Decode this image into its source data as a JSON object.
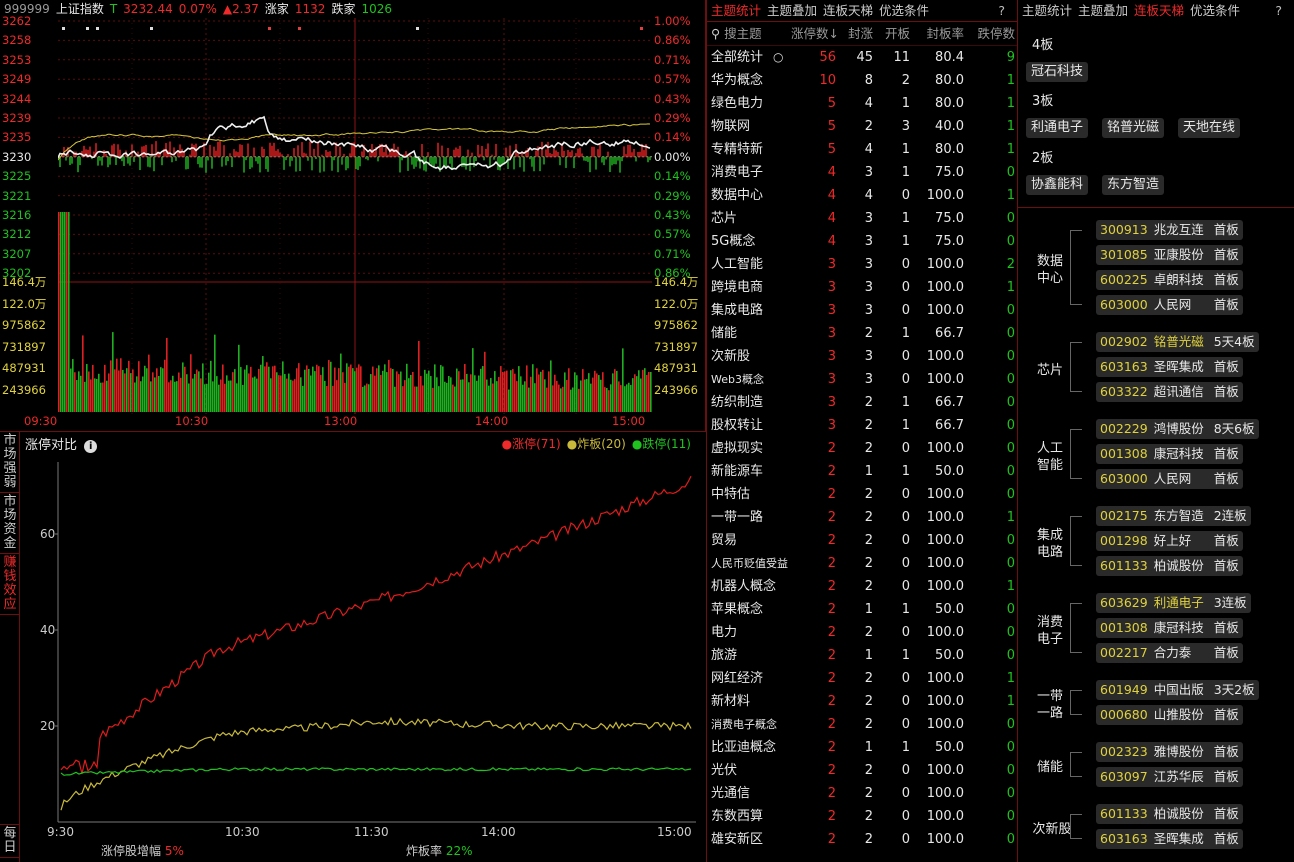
{
  "index": {
    "code": "999999",
    "name": "上证指数",
    "flag": "T",
    "price": "3232.44",
    "pct": "0.07%",
    "chg": "▲2.37",
    "up_label": "涨家",
    "up": "1132",
    "down_label": "跌家",
    "down": "1026"
  },
  "left_axis": [
    "3262",
    "3258",
    "3253",
    "3249",
    "3244",
    "3239",
    "3235",
    "3230",
    "3225",
    "3221",
    "3216",
    "3212",
    "3207",
    "3202"
  ],
  "right_axis": [
    "1.00%",
    "0.86%",
    "0.71%",
    "0.57%",
    "0.43%",
    "0.29%",
    "0.14%",
    "0.00%",
    "0.14%",
    "0.29%",
    "0.43%",
    "0.57%",
    "0.71%",
    "0.86%"
  ],
  "vol_axis": [
    "146.4万",
    "122.0万",
    "975862",
    "731897",
    "487931",
    "243966"
  ],
  "time_axis": [
    "09:30",
    "10:30",
    "13:00",
    "14:00",
    "15:00"
  ],
  "compare": {
    "title": "涨停对比",
    "legend": [
      {
        "label": "涨停(71)",
        "color": "#ee2a2a"
      },
      {
        "label": "炸板(20)",
        "color": "#c9b93a"
      },
      {
        "label": "跌停(11)",
        "color": "#1fc21f"
      }
    ],
    "y_ticks": [
      "60",
      "40",
      "20"
    ],
    "x_ticks": [
      "9:30",
      "10:30",
      "11:30",
      "14:00",
      "15:00"
    ],
    "footer_left_label": "涨停股增幅",
    "footer_left_value": "5%",
    "footer_right_label": "炸板率",
    "footer_right_value": "22%"
  },
  "chart_data": {
    "type": "line",
    "title": "涨停对比",
    "x": [
      "9:30",
      "10:30",
      "11:30",
      "14:00",
      "15:00"
    ],
    "series": [
      {
        "name": "涨停(71)",
        "values": [
          12,
          36,
          46,
          58,
          71
        ]
      },
      {
        "name": "炸板(20)",
        "values": [
          3,
          18,
          21,
          20,
          20
        ]
      },
      {
        "name": "跌停(11)",
        "values": [
          10,
          11,
          11,
          11,
          11
        ]
      }
    ],
    "ylim": [
      0,
      75
    ]
  },
  "side_tabs": [
    {
      "label": "市场强弱",
      "active": false
    },
    {
      "label": "市场资金",
      "active": false
    },
    {
      "label": "赚钱效应",
      "active": true
    },
    {
      "label": "每日",
      "active": false
    }
  ],
  "table_tabs": [
    "主题统计",
    "主题叠加",
    "连板天梯",
    "优选条件"
  ],
  "table_headers": [
    "搜主题",
    "涨停数↓",
    "封涨",
    "开板",
    "封板率",
    "跌停数"
  ],
  "rows": [
    [
      "全部统计",
      "56",
      "45",
      "11",
      "80.4",
      "9"
    ],
    [
      "华为概念",
      "10",
      "8",
      "2",
      "80.0",
      "1"
    ],
    [
      "绿色电力",
      "5",
      "4",
      "1",
      "80.0",
      "1"
    ],
    [
      "物联网",
      "5",
      "2",
      "3",
      "40.0",
      "1"
    ],
    [
      "专精特新",
      "5",
      "4",
      "1",
      "80.0",
      "1"
    ],
    [
      "消费电子",
      "4",
      "3",
      "1",
      "75.0",
      "0"
    ],
    [
      "数据中心",
      "4",
      "4",
      "0",
      "100.0",
      "1"
    ],
    [
      "芯片",
      "4",
      "3",
      "1",
      "75.0",
      "0"
    ],
    [
      "5G概念",
      "4",
      "3",
      "1",
      "75.0",
      "0"
    ],
    [
      "人工智能",
      "3",
      "3",
      "0",
      "100.0",
      "2"
    ],
    [
      "跨境电商",
      "3",
      "3",
      "0",
      "100.0",
      "1"
    ],
    [
      "集成电路",
      "3",
      "3",
      "0",
      "100.0",
      "0"
    ],
    [
      "储能",
      "3",
      "2",
      "1",
      "66.7",
      "0"
    ],
    [
      "次新股",
      "3",
      "3",
      "0",
      "100.0",
      "0"
    ],
    [
      "Web3概念",
      "3",
      "3",
      "0",
      "100.0",
      "0"
    ],
    [
      "纺织制造",
      "3",
      "2",
      "1",
      "66.7",
      "0"
    ],
    [
      "股权转让",
      "3",
      "2",
      "1",
      "66.7",
      "0"
    ],
    [
      "虚拟现实",
      "2",
      "2",
      "0",
      "100.0",
      "0"
    ],
    [
      "新能源车",
      "2",
      "1",
      "1",
      "50.0",
      "0"
    ],
    [
      "中特估",
      "2",
      "2",
      "0",
      "100.0",
      "0"
    ],
    [
      "一带一路",
      "2",
      "2",
      "0",
      "100.0",
      "1"
    ],
    [
      "贸易",
      "2",
      "2",
      "0",
      "100.0",
      "0"
    ],
    [
      "人民币贬值受益",
      "2",
      "2",
      "0",
      "100.0",
      "0"
    ],
    [
      "机器人概念",
      "2",
      "2",
      "0",
      "100.0",
      "1"
    ],
    [
      "苹果概念",
      "2",
      "1",
      "1",
      "50.0",
      "0"
    ],
    [
      "电力",
      "2",
      "2",
      "0",
      "100.0",
      "0"
    ],
    [
      "旅游",
      "2",
      "1",
      "1",
      "50.0",
      "0"
    ],
    [
      "网红经济",
      "2",
      "2",
      "0",
      "100.0",
      "1"
    ],
    [
      "新材料",
      "2",
      "2",
      "0",
      "100.0",
      "1"
    ],
    [
      "消费电子概念",
      "2",
      "2",
      "0",
      "100.0",
      "0"
    ],
    [
      "比亚迪概念",
      "2",
      "1",
      "1",
      "50.0",
      "0"
    ],
    [
      "光伏",
      "2",
      "2",
      "0",
      "100.0",
      "0"
    ],
    [
      "光通信",
      "2",
      "2",
      "0",
      "100.0",
      "0"
    ],
    [
      "东数西算",
      "2",
      "2",
      "0",
      "100.0",
      "0"
    ],
    [
      "雄安新区",
      "2",
      "2",
      "0",
      "100.0",
      "0"
    ]
  ],
  "ladder_tabs": [
    "主题统计",
    "主题叠加",
    "连板天梯",
    "优选条件"
  ],
  "boards": [
    {
      "label": "4板",
      "chips": [
        "冠石科技"
      ]
    },
    {
      "label": "3板",
      "chips": [
        "利通电子",
        "铭普光磁",
        "天地在线"
      ]
    },
    {
      "label": "2板",
      "chips": [
        "协鑫能科",
        "东方智造"
      ]
    }
  ],
  "categories": [
    {
      "name": "数据中心",
      "stocks": [
        [
          "300913",
          "兆龙互连",
          "首板",
          false
        ],
        [
          "301085",
          "亚康股份",
          "首板",
          false
        ],
        [
          "600225",
          "卓朗科技",
          "首板",
          false
        ],
        [
          "603000",
          "人民网",
          "首板",
          false
        ]
      ]
    },
    {
      "name": "芯片",
      "stocks": [
        [
          "002902",
          "铭普光磁",
          "5天4板",
          true
        ],
        [
          "603163",
          "圣晖集成",
          "首板",
          false
        ],
        [
          "603322",
          "超讯通信",
          "首板",
          false
        ]
      ]
    },
    {
      "name": "人工智能",
      "stocks": [
        [
          "002229",
          "鸿博股份",
          "8天6板",
          false
        ],
        [
          "001308",
          "康冠科技",
          "首板",
          false
        ],
        [
          "603000",
          "人民网",
          "首板",
          false
        ]
      ]
    },
    {
      "name": "集成电路",
      "stocks": [
        [
          "002175",
          "东方智造",
          "2连板",
          false
        ],
        [
          "001298",
          "好上好",
          "首板",
          false
        ],
        [
          "601133",
          "柏诚股份",
          "首板",
          false
        ]
      ]
    },
    {
      "name": "消费电子",
      "stocks": [
        [
          "603629",
          "利通电子",
          "3连板",
          true
        ],
        [
          "001308",
          "康冠科技",
          "首板",
          false
        ],
        [
          "002217",
          "合力泰",
          "首板",
          false
        ]
      ]
    },
    {
      "name": "一带一路",
      "stocks": [
        [
          "601949",
          "中国出版",
          "3天2板",
          false
        ],
        [
          "000680",
          "山推股份",
          "首板",
          false
        ]
      ]
    },
    {
      "name": "储能",
      "stocks": [
        [
          "002323",
          "雅博股份",
          "首板",
          false
        ],
        [
          "603097",
          "江苏华辰",
          "首板",
          false
        ]
      ]
    },
    {
      "name": "次新股",
      "stocks": [
        [
          "601133",
          "柏诚股份",
          "首板",
          false
        ],
        [
          "603163",
          "圣晖集成",
          "首板",
          false
        ]
      ]
    }
  ],
  "help_icon": "?"
}
